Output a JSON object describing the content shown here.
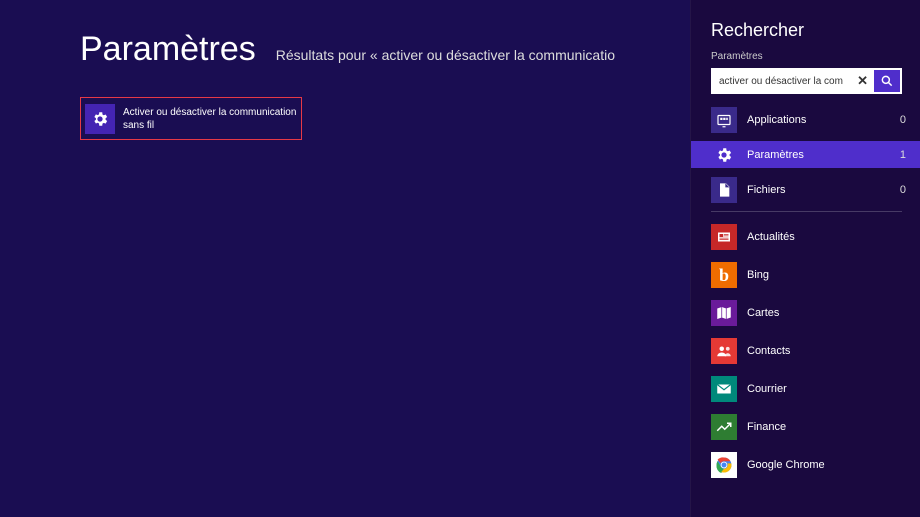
{
  "main": {
    "title": "Paramètres",
    "subtitle": "Résultats pour « activer ou désactiver la communicatio",
    "result_label": "Activer ou désactiver la communication sans fil"
  },
  "charm": {
    "title": "Rechercher",
    "scope_label": "Paramètres",
    "search_value": "activer ou désactiver la com",
    "scopes": [
      {
        "label": "Applications",
        "count": "0",
        "icon": "apps-icon",
        "bg": "#3a2a8a"
      },
      {
        "label": "Paramètres",
        "count": "1",
        "icon": "gear-icon",
        "bg": "#4f2ecb",
        "active": true
      },
      {
        "label": "Fichiers",
        "count": "0",
        "icon": "file-icon",
        "bg": "#3a2a8a"
      }
    ],
    "apps": [
      {
        "label": "Actualités",
        "icon": "news-icon",
        "bg": "#c62828"
      },
      {
        "label": "Bing",
        "icon": "bing-icon",
        "bg": "#ef6c00"
      },
      {
        "label": "Cartes",
        "icon": "maps-icon",
        "bg": "#6a1b9a"
      },
      {
        "label": "Contacts",
        "icon": "contacts-icon",
        "bg": "#e53935"
      },
      {
        "label": "Courrier",
        "icon": "mail-icon",
        "bg": "#00897b"
      },
      {
        "label": "Finance",
        "icon": "finance-icon",
        "bg": "#2e7d32"
      },
      {
        "label": "Google Chrome",
        "icon": "chrome-icon",
        "bg": "#ffffff"
      }
    ]
  }
}
